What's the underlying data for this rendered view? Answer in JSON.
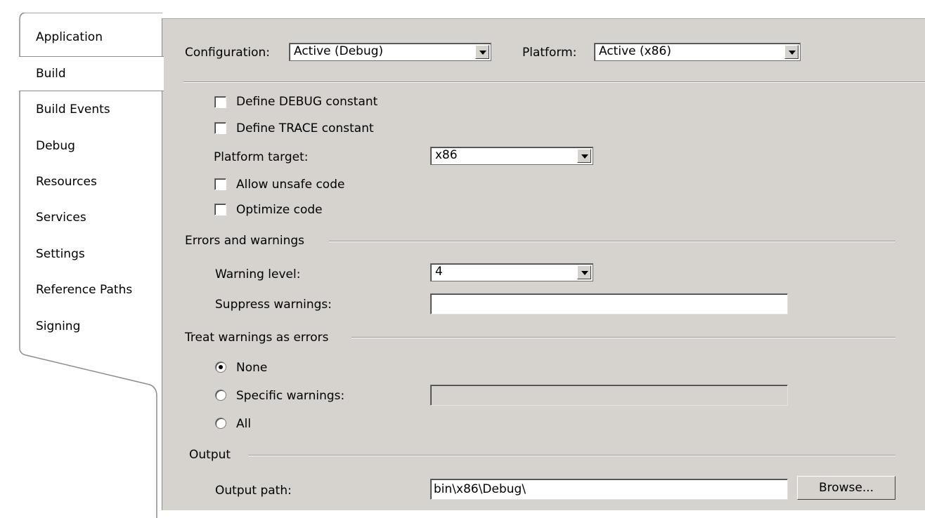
{
  "tabs": [
    {
      "label": "Application"
    },
    {
      "label": "Build"
    },
    {
      "label": "Build Events"
    },
    {
      "label": "Debug"
    },
    {
      "label": "Resources"
    },
    {
      "label": "Services"
    },
    {
      "label": "Settings"
    },
    {
      "label": "Reference Paths"
    },
    {
      "label": "Signing"
    }
  ],
  "selected_tab": "Build",
  "header": {
    "configuration_label": "Configuration:",
    "configuration_value": "Active (Debug)",
    "platform_label": "Platform:",
    "platform_value": "Active (x86)"
  },
  "general": {
    "define_debug": {
      "label": "Define DEBUG constant",
      "checked": false
    },
    "define_trace": {
      "label": "Define TRACE constant",
      "checked": false
    },
    "platform_target_label": "Platform target:",
    "platform_target_value": "x86",
    "allow_unsafe": {
      "label": "Allow unsafe code",
      "checked": false
    },
    "optimize": {
      "label": "Optimize code",
      "checked": false
    }
  },
  "errors": {
    "section_title": "Errors and warnings",
    "warning_level_label": "Warning level:",
    "warning_level_value": "4",
    "suppress_label": "Suppress warnings:",
    "suppress_value": ""
  },
  "treat_warnings": {
    "section_title": "Treat warnings as errors",
    "none_label": "None",
    "specific_label": "Specific warnings:",
    "specific_value": "",
    "all_label": "All",
    "selected": "None"
  },
  "output": {
    "section_title": "Output",
    "path_label": "Output path:",
    "path_value": "bin\\x86\\Debug\\",
    "browse_label": "Browse..."
  }
}
